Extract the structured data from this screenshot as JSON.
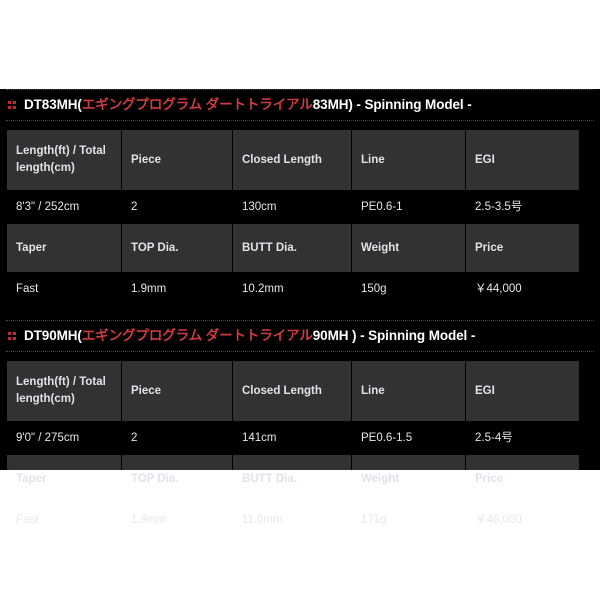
{
  "theme": {
    "page_background": "#ffffff",
    "panel_background": "#000000",
    "header_cell_background": "#333132",
    "accent_red": "#cc2229",
    "title_jp_red": "#cf3b42",
    "text_white": "#ffffff",
    "header_text": "#dfe3ea",
    "data_text": "#e8e8e8",
    "divider": "#4a4a4a"
  },
  "sections": [
    {
      "bullet_icon": "red-square-grid-icon",
      "title_model": "DT83MH",
      "title_open_paren": "(",
      "title_jp": "エギングプログラム ダートトライアル",
      "title_code": "83MH)",
      "title_suffix": " - Spinning Model -",
      "table": {
        "headers_row1": [
          "Length(ft) / Total length(cm)",
          "Piece",
          "Closed Length",
          "Line",
          "EGI"
        ],
        "values_row1": [
          "8'3\" / 252cm",
          "2",
          "130cm",
          "PE0.6-1",
          "2.5-3.5号"
        ],
        "headers_row2": [
          "Taper",
          "TOP Dia.",
          "BUTT Dia.",
          "Weight",
          "Price"
        ],
        "values_row2": [
          "Fast",
          "1.9mm",
          "10.2mm",
          "150g",
          "￥44,000"
        ]
      }
    },
    {
      "bullet_icon": "red-square-grid-icon",
      "title_model": "DT90MH",
      "title_open_paren": "(",
      "title_jp": "エギングプログラム ダートトライアル",
      "title_code": "90MH )",
      "title_suffix": " - Spinning Model -",
      "table": {
        "headers_row1": [
          "Length(ft) / Total length(cm)",
          "Piece",
          "Closed Length",
          "Line",
          "EGI"
        ],
        "values_row1": [
          "9'0\" / 275cm",
          "2",
          "141cm",
          "PE0.6-1.5",
          "2.5-4号"
        ],
        "headers_row2": [
          "Taper",
          "TOP Dia.",
          "BUTT Dia.",
          "Weight",
          "Price"
        ],
        "values_row2": [
          "Fast",
          "1.9mm",
          "11.0mm",
          "171g",
          "￥46,000"
        ]
      }
    }
  ]
}
